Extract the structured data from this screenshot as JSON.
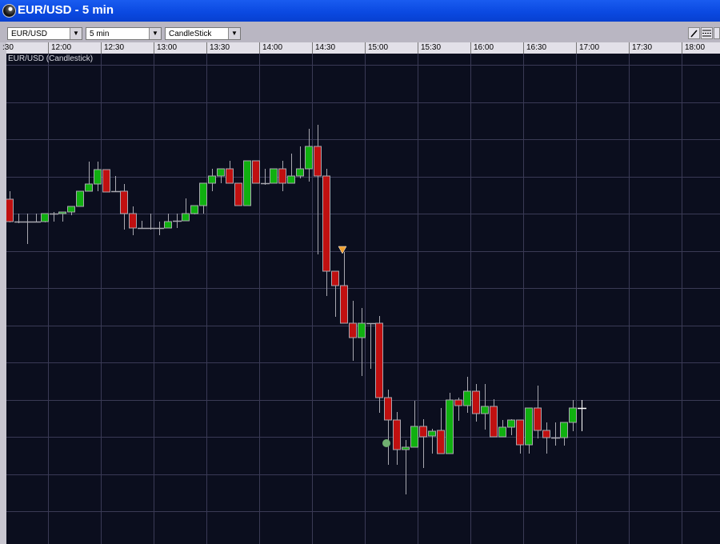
{
  "window": {
    "title": "EUR/USD - 5 min"
  },
  "toolbar": {
    "symbol": "EUR/USD",
    "interval": "5 min",
    "chart_type": "CandleStick",
    "draw_line_tool": "line-tool-icon",
    "properties_tool": "lines-tool-icon"
  },
  "chart_label": "EUR/USD (Candlestick)",
  "colors": {
    "up": "#10b010",
    "down": "#c01010",
    "grid": "#3a3a55",
    "background": "#0b0e1e"
  },
  "chart_data": {
    "type": "candlestick",
    "title": "EUR/USD (Candlestick)",
    "x_ticks": [
      ":30",
      "12:00",
      "12:30",
      "13:00",
      "13:30",
      "14:00",
      "14:30",
      "15:00",
      "15:30",
      "16:00",
      "16:30",
      "17:00",
      "17:30",
      "18:00"
    ],
    "interval": "5 min",
    "price_units": "relative (no price axis shown)",
    "candles_ohlc": [
      [
        351,
        361,
        322,
        323
      ],
      [
        323,
        333,
        321,
        323
      ],
      [
        323,
        333,
        295,
        323
      ],
      [
        323,
        333,
        323,
        323
      ],
      [
        323,
        333,
        322,
        333
      ],
      [
        333,
        335,
        323,
        333
      ],
      [
        333,
        335,
        323,
        335
      ],
      [
        335,
        342,
        331,
        342
      ],
      [
        342,
        361,
        342,
        361
      ],
      [
        361,
        398,
        361,
        370
      ],
      [
        370,
        398,
        361,
        388
      ],
      [
        388,
        388,
        360,
        360
      ],
      [
        361,
        380,
        361,
        361
      ],
      [
        361,
        370,
        313,
        333
      ],
      [
        333,
        342,
        306,
        315
      ],
      [
        315,
        324,
        315,
        315
      ],
      [
        315,
        333,
        313,
        315
      ],
      [
        315,
        323,
        306,
        315
      ],
      [
        315,
        333,
        315,
        323
      ],
      [
        324,
        333,
        315,
        324
      ],
      [
        324,
        352,
        324,
        333
      ],
      [
        333,
        343,
        332,
        343
      ],
      [
        343,
        371,
        333,
        371
      ],
      [
        371,
        389,
        361,
        380
      ],
      [
        380,
        389,
        371,
        389
      ],
      [
        389,
        399,
        371,
        371
      ],
      [
        371,
        371,
        343,
        343
      ],
      [
        343,
        399,
        343,
        399
      ],
      [
        399,
        399,
        371,
        371
      ],
      [
        371,
        389,
        369,
        371
      ],
      [
        371,
        389,
        371,
        389
      ],
      [
        389,
        399,
        361,
        371
      ],
      [
        371,
        408,
        371,
        380
      ],
      [
        380,
        417,
        377,
        389
      ],
      [
        389,
        439,
        373,
        417
      ],
      [
        417,
        444,
        282,
        380
      ],
      [
        380,
        389,
        230,
        261
      ],
      [
        261,
        261,
        204,
        243
      ],
      [
        243,
        285,
        196,
        196
      ],
      [
        196,
        224,
        149,
        178
      ],
      [
        178,
        215,
        130,
        196
      ],
      [
        196,
        196,
        139,
        196
      ],
      [
        196,
        205,
        84,
        103
      ],
      [
        103,
        113,
        19,
        75
      ],
      [
        75,
        85,
        19,
        38
      ],
      [
        38,
        50,
        -18,
        41
      ],
      [
        41,
        99,
        41,
        67
      ],
      [
        67,
        76,
        15,
        54
      ],
      [
        55,
        64,
        33,
        61
      ],
      [
        62,
        90,
        33,
        33
      ],
      [
        33,
        109,
        33,
        100
      ],
      [
        100,
        103,
        74,
        93
      ],
      [
        93,
        129,
        84,
        111
      ],
      [
        111,
        120,
        73,
        83
      ],
      [
        83,
        120,
        63,
        92
      ],
      [
        92,
        101,
        54,
        54
      ],
      [
        54,
        75,
        54,
        66
      ],
      [
        66,
        76,
        56,
        75
      ],
      [
        75,
        75,
        33,
        44
      ],
      [
        44,
        90,
        33,
        90
      ],
      [
        90,
        118,
        52,
        62
      ],
      [
        62,
        72,
        33,
        53
      ],
      [
        53,
        72,
        43,
        53
      ],
      [
        53,
        72,
        43,
        72
      ],
      [
        72,
        100,
        61,
        90
      ],
      [
        90,
        100,
        61,
        90
      ]
    ],
    "markers": [
      {
        "type": "sell-arrow",
        "candle_index": 38,
        "price": 287,
        "color": "#f0a030"
      },
      {
        "type": "buy-dot",
        "candle_index": 43,
        "price": 46,
        "color": "#70b070"
      }
    ],
    "grid": true
  }
}
